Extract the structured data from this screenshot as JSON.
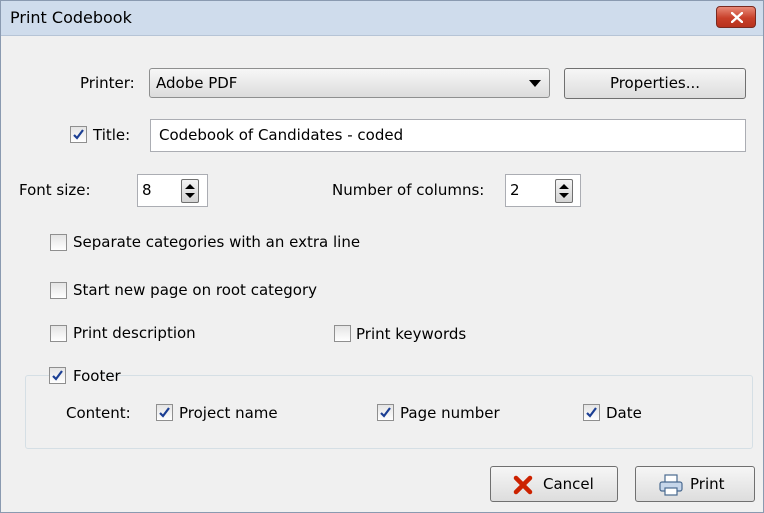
{
  "dialog": {
    "title": "Print Codebook",
    "printer_label": "Printer:",
    "printer_value": "Adobe PDF",
    "properties_label": "Properties...",
    "title_checkbox_label": "Title:",
    "title_checked": true,
    "title_value": "Codebook of Candidates - coded",
    "font_size_label": "Font size:",
    "font_size_value": "8",
    "columns_label": "Number of columns:",
    "columns_value": "2",
    "options": [
      {
        "label": "Separate categories with an extra line",
        "checked": false
      },
      {
        "label": "Start new page on root category",
        "checked": false
      },
      {
        "label": "Print description",
        "checked": false
      },
      {
        "label": "Print keywords",
        "checked": false
      }
    ],
    "footer": {
      "label": "Footer",
      "checked": true,
      "content_label": "Content:",
      "items": [
        {
          "label": "Project name",
          "checked": true
        },
        {
          "label": "Page number",
          "checked": true
        },
        {
          "label": "Date",
          "checked": true
        }
      ]
    },
    "cancel_label": "Cancel",
    "print_label": "Print"
  },
  "colors": {
    "titlebar": "#cfdcec",
    "close_button": "#c8402a",
    "dialog_background": "#f0f0f0",
    "cancel_icon": "#cc2200",
    "checkmark": "#1c3f94"
  },
  "icons": {
    "close": "close-icon",
    "cancel": "red-x-icon",
    "print": "printer-icon",
    "spin": "spin-up-down-icon"
  }
}
